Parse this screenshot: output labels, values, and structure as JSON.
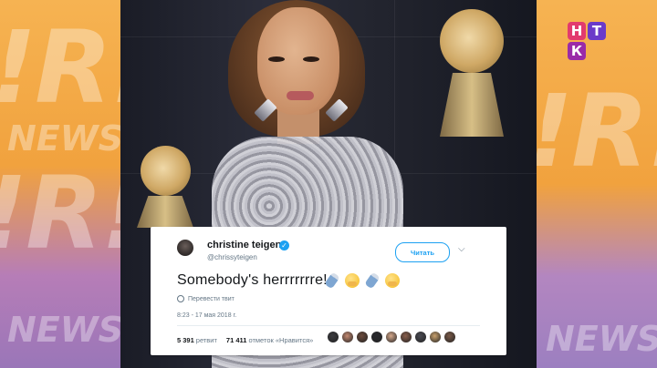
{
  "channel_logo": {
    "letters": [
      "Н",
      "Т",
      "К"
    ],
    "colors": [
      "#e23a6e",
      "#6b3ac9",
      "#9a2ba8"
    ]
  },
  "background": {
    "left_panel_color": "#f1a23e",
    "right_panel_color": "#f6b352",
    "watermark_word": "NEWS",
    "watermark_big": "!R!"
  },
  "tweet": {
    "display_name": "christine teigen",
    "handle": "@chrissyteigen",
    "follow_label": "Читать",
    "text": "Somebody's herrrrrrre!",
    "emojis": [
      "baby-bottle-icon",
      "hugging-face-icon",
      "baby-bottle-icon",
      "hugging-face-icon"
    ],
    "translate_label": "Перевести твит",
    "timestamp": "8:23 - 17 мая 2018 г.",
    "retweets_count": "5 391",
    "retweets_label": "ретвит",
    "likes_count": "71 411",
    "likes_label": "отметок «Нравится»",
    "liker_avatar_colors": [
      "#3b3b3f",
      "#c58a72",
      "#6d4c3d",
      "#2a2a2e",
      "#d6a98c",
      "#8a5f4c",
      "#4a4a52",
      "#c9a16d",
      "#7a5a48"
    ]
  }
}
